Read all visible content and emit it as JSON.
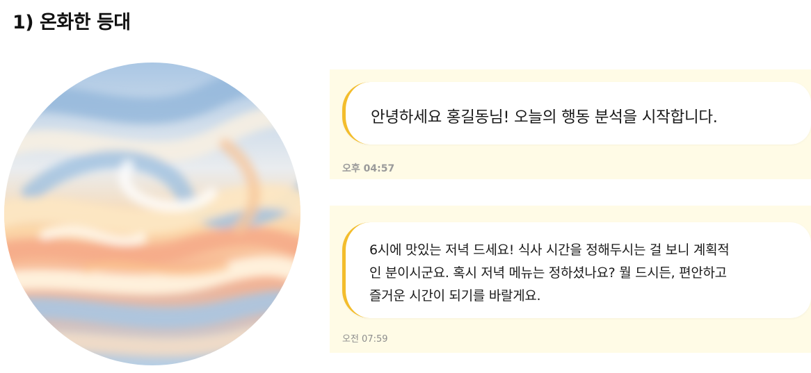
{
  "section": {
    "title": "1) 온화한 등대"
  },
  "avatar": {
    "icon": "swirl-sunset-avatar-icon"
  },
  "messages": [
    {
      "lines": [
        "안녕하세요 홍길동님! 오늘의 행동 분석을 시작합니다."
      ],
      "time": "오후 04:57"
    },
    {
      "lines": [
        "6시에 맛있는 저녁 드세요! 식사 시간을 정해두시는 걸 보니 계획적",
        "인 분이시군요. 혹시 저녁 메뉴는 정하셨나요? 뭘 드시든, 편안하고",
        "즐거운 시간이 되기를 바랄게요."
      ],
      "time": "오전 07:59"
    }
  ],
  "colors": {
    "card_background": "#fffbe6",
    "bubble_background": "#ffffff",
    "accent_border": "#f3bd2c",
    "timestamp": "#9a9a9a"
  }
}
